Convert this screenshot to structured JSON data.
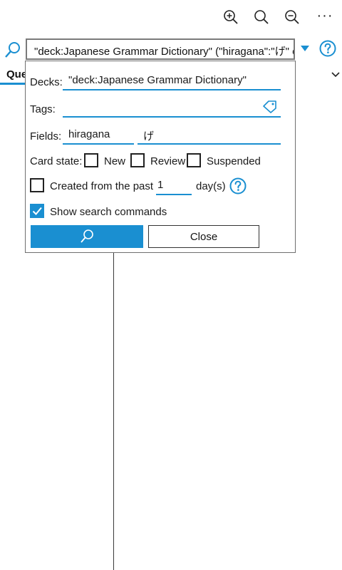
{
  "toolbar": {
    "icons": [
      "zoom-in-icon",
      "search-icon",
      "zoom-out-icon",
      "more-icon"
    ],
    "more_label": "···"
  },
  "search": {
    "query": "\"deck:Japanese Grammar Dictionary\" (\"hiragana\":\"げ\" o"
  },
  "tab": {
    "label": "Que"
  },
  "panel": {
    "decks_label": "Decks:",
    "decks_value": "\"deck:Japanese Grammar Dictionary\"",
    "tags_label": "Tags:",
    "tags_value": "",
    "fields_label": "Fields:",
    "field_name": "hiragana",
    "field_value": "げ",
    "card_state_label": "Card state:",
    "card_states": [
      {
        "label": "New",
        "checked": false
      },
      {
        "label": "Review",
        "checked": false
      },
      {
        "label": "Suspended",
        "checked": false
      }
    ],
    "created_label": "Created from the past",
    "created_days": "1",
    "days_suffix": "day(s)",
    "created_checked": false,
    "show_commands_label": "Show search commands",
    "show_commands_checked": true,
    "close_label": "Close"
  },
  "colors": {
    "accent": "#1a8fd1",
    "border": "#7a7a7a"
  }
}
